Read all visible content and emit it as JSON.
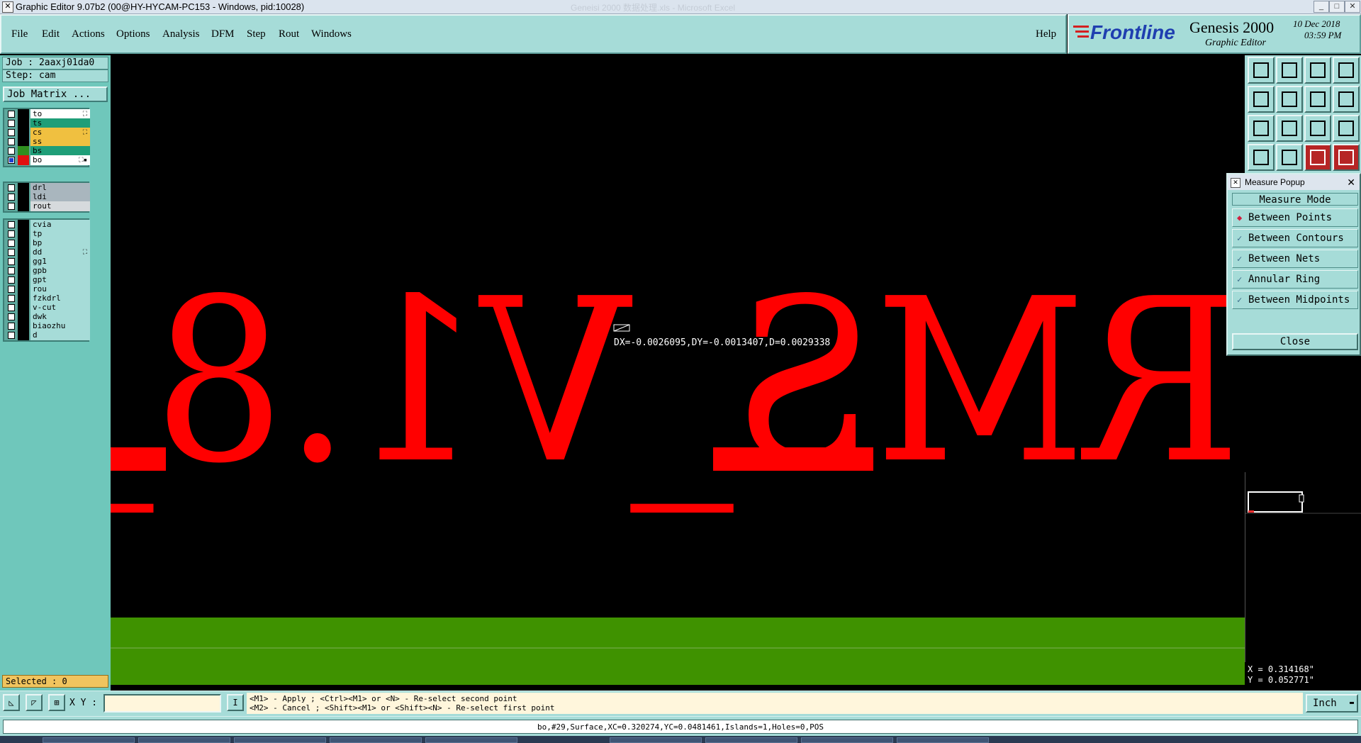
{
  "window": {
    "title": "Graphic Editor 9.07b2 (00@HY-HYCAM-PC153 - Windows, pid:10028)",
    "ghost_title": "Geneisi 2000  数据处理.xls  -  Microsoft Excel"
  },
  "menu": {
    "items": [
      "File",
      "Edit",
      "Actions",
      "Options",
      "Analysis",
      "DFM",
      "Step",
      "Rout",
      "Windows"
    ],
    "help": "Help"
  },
  "brand": {
    "logo": "Frontline",
    "product": "Genesis 2000",
    "subtitle": "Graphic Editor",
    "date": "10 Dec 2018",
    "time": "03:59 PM"
  },
  "job": {
    "job_label": "Job : 2aaxj01da0",
    "step_label": "Step: cam",
    "matrix_button": "Job Matrix ..."
  },
  "layers": {
    "group1": [
      {
        "name": "to",
        "color": "#ffffff",
        "swatch": "#000000",
        "mark": "⛶",
        "checked": false
      },
      {
        "name": "ts",
        "color": "#1f9e78",
        "swatch": "#000000",
        "mark": "",
        "checked": false
      },
      {
        "name": "cs",
        "color": "#f0c040",
        "swatch": "#000000",
        "mark": "⛶",
        "checked": false
      },
      {
        "name": "ss",
        "color": "#f0c040",
        "swatch": "#000000",
        "mark": "",
        "checked": false
      },
      {
        "name": "bs",
        "color": "#1f9e78",
        "swatch": "#2f8f1f",
        "mark": "",
        "checked": false
      },
      {
        "name": "bo",
        "color": "#ffffff",
        "swatch": "#e01010",
        "mark": "⛶▪",
        "checked": true
      }
    ],
    "group2": [
      {
        "name": "drl",
        "color": "#a9b6be",
        "swatch": "#000000",
        "mark": "",
        "checked": false
      },
      {
        "name": "ldi",
        "color": "#a9b6be",
        "swatch": "#000000",
        "mark": "",
        "checked": false
      },
      {
        "name": "rout",
        "color": "#d6dadd",
        "swatch": "#000000",
        "mark": "",
        "checked": false
      }
    ],
    "group3": [
      {
        "name": "cvia",
        "color": "#a6dcd8",
        "mark": ""
      },
      {
        "name": "tp",
        "color": "#a6dcd8",
        "mark": ""
      },
      {
        "name": "bp",
        "color": "#a6dcd8",
        "mark": ""
      },
      {
        "name": "dd",
        "color": "#a6dcd8",
        "mark": "⛶"
      },
      {
        "name": "gg1",
        "color": "#a6dcd8",
        "mark": ""
      },
      {
        "name": "gpb",
        "color": "#a6dcd8",
        "mark": ""
      },
      {
        "name": "gpt",
        "color": "#a6dcd8",
        "mark": ""
      },
      {
        "name": "rou",
        "color": "#a6dcd8",
        "mark": ""
      },
      {
        "name": "fzkdrl",
        "color": "#a6dcd8",
        "mark": ""
      },
      {
        "name": "v-cut",
        "color": "#a6dcd8",
        "mark": ""
      },
      {
        "name": "dwk",
        "color": "#a6dcd8",
        "mark": ""
      },
      {
        "name": "biaozhu",
        "color": "#a6dcd8",
        "mark": ""
      },
      {
        "name": "d",
        "color": "#a6dcd8",
        "mark": ""
      }
    ],
    "selected_label": "Selected : 0"
  },
  "canvas": {
    "graphic_text": "RMS_V1.8_",
    "measure_readout": "DX=-0.0026095,DY=-0.0013407,D=0.0029338",
    "colors": {
      "feature": "#ff0000",
      "board": "#3f9200",
      "background": "#000000"
    }
  },
  "cursor": {
    "x_label": "X = 0.314168\"",
    "y_label": "Y = 0.052771\""
  },
  "measure_popup": {
    "title": "Measure Popup",
    "mode_header": "Measure Mode",
    "options": [
      "Between Points",
      "Between Contours",
      "Between Nets",
      "Annular Ring",
      "Between Midpoints"
    ],
    "selected_index": 0,
    "close": "Close"
  },
  "commandbar": {
    "xy_label": "X Y :",
    "xy_value": "",
    "hint_line1": "<M1> - Apply  ; <Ctrl><M1> or <N> - Re-select second point",
    "hint_line2": "<M2> - Cancel ; <Shift><M1> or <Shift><N> - Re-select first point",
    "unit": "Inch"
  },
  "status": {
    "text": "bo,#29,Surface,XC=0.320274,YC=0.0481461,Islands=1,Holes=0,POS"
  }
}
